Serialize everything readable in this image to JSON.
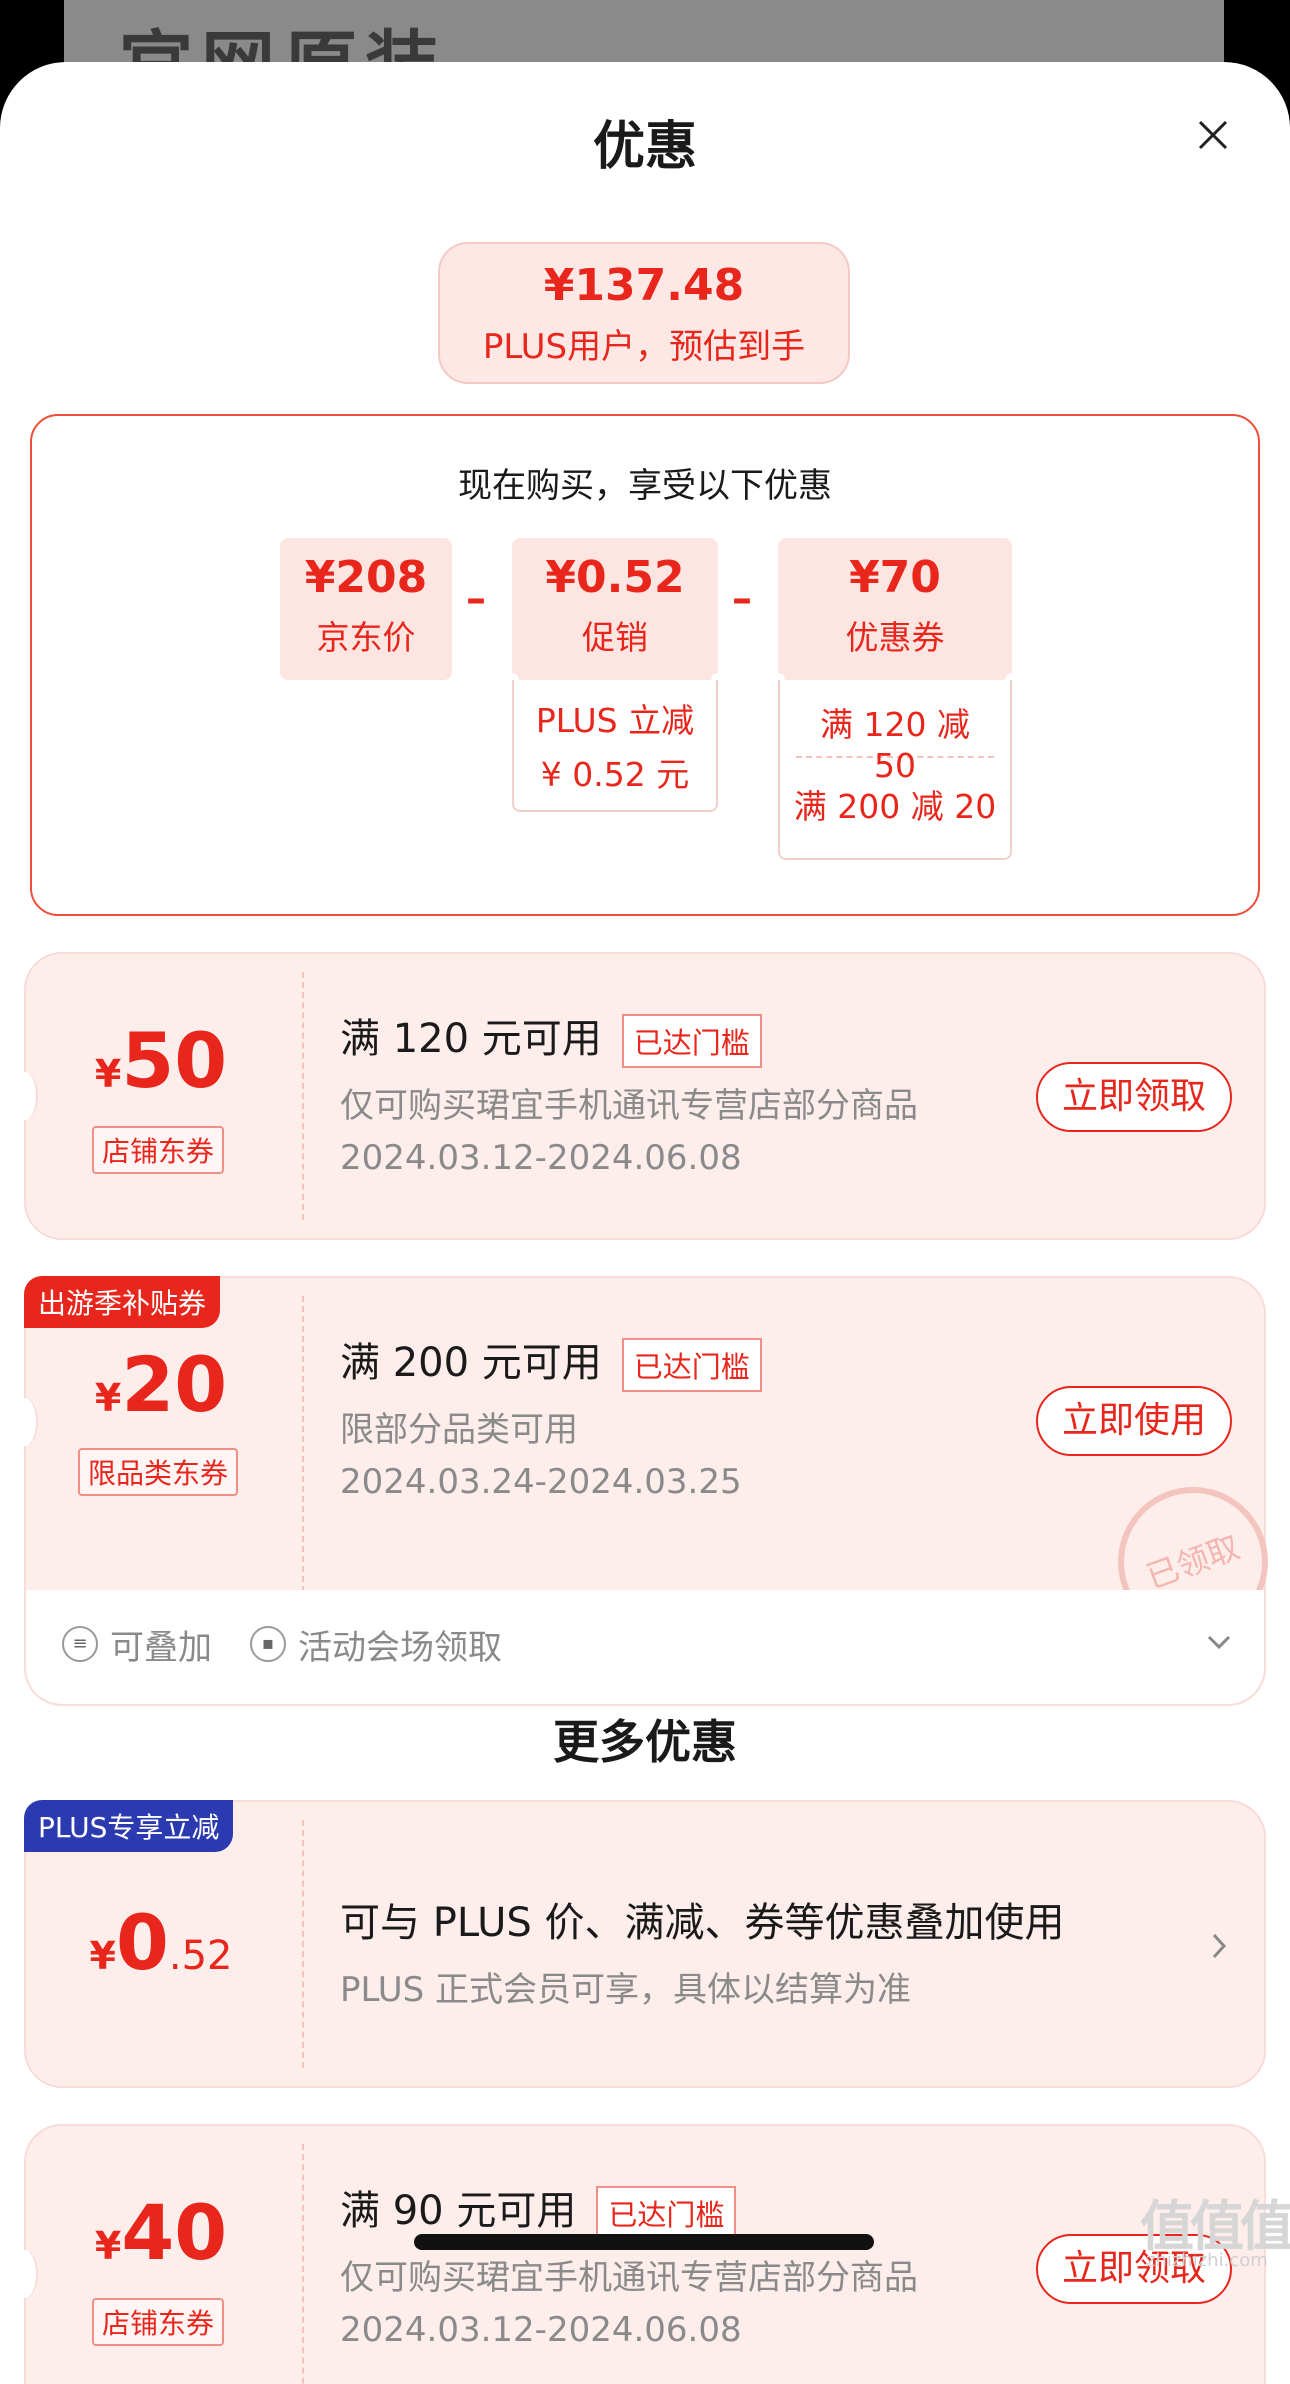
{
  "background": {
    "title_text": "官网原装"
  },
  "sheet": {
    "title": "优惠",
    "close_icon": "close-icon"
  },
  "estimate": {
    "price": "¥137.48",
    "label": "PLUS用户，预估到手"
  },
  "breakdown": {
    "heading": "现在购买，享受以下优惠",
    "jd_price": {
      "value": "¥208",
      "label": "京东价"
    },
    "minus": "–",
    "promo": {
      "value": "¥0.52",
      "label": "促销",
      "detail_line1": "PLUS 立减",
      "detail_line2": "¥ 0.52 元"
    },
    "coupon": {
      "value": "¥70",
      "label": "优惠券",
      "items": [
        "满 120 减 50",
        "满 200 减 20"
      ]
    }
  },
  "coupons": [
    {
      "currency": "¥",
      "amount": "50",
      "type": "店铺东券",
      "condition": "满 120 元可用",
      "reached": "已达门槛",
      "desc": "仅可购买珺宜手机通讯专营店部分商品",
      "date": "2024.03.12-2024.06.08",
      "button": "立即领取"
    },
    {
      "corner": "出游季补贴券",
      "currency": "¥",
      "amount": "20",
      "type": "限品类东券",
      "condition": "满 200 元可用",
      "reached": "已达门槛",
      "desc": "限部分品类可用",
      "date": "2024.03.24-2024.03.25",
      "button": "立即使用",
      "stamp": "已领取"
    }
  ],
  "coupon_footer": {
    "stackable": "可叠加",
    "venue": "活动会场领取"
  },
  "more": {
    "heading": "更多优惠",
    "plus_card": {
      "corner": "PLUS专享立减",
      "currency": "¥",
      "amount_int": "0",
      "amount_dec": ".52",
      "title": "可与 PLUS 价、满减、券等优惠叠加使用",
      "desc": "PLUS 正式会员可享，具体以结算为准"
    },
    "coupon3": {
      "currency": "¥",
      "amount": "40",
      "type": "店铺东券",
      "condition": "满 90 元可用",
      "reached": "已达门槛",
      "desc": "仅可购买珺宜手机通讯专营店部分商品",
      "date": "2024.03.12-2024.06.08",
      "button": "立即领取"
    }
  },
  "watermark": {
    "main": "值值值",
    "sub": "zhizhizhi.com"
  },
  "colors": {
    "accent": "#e8261c",
    "plus_blue": "#2b3ab0",
    "pink_bg": "#fdeeec"
  }
}
